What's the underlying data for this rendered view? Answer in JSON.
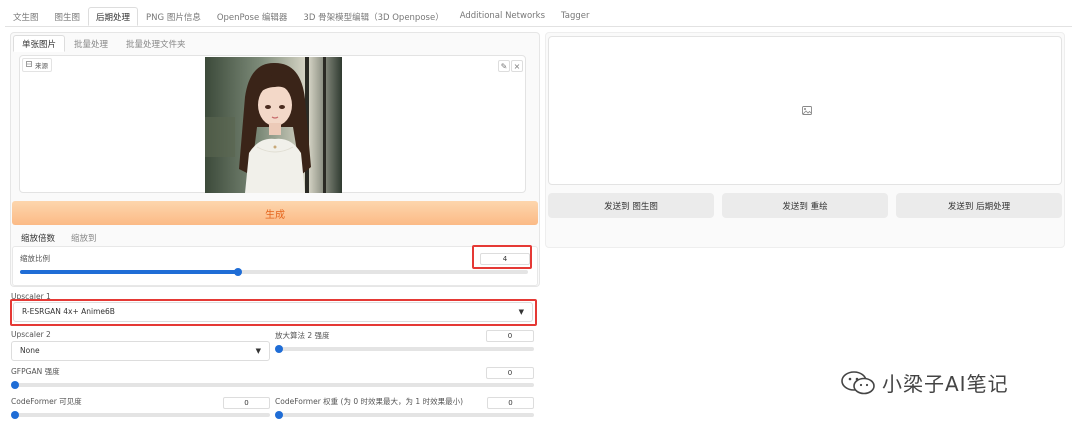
{
  "tabs": [
    "文生图",
    "图生图",
    "后期处理",
    "PNG 图片信息",
    "OpenPose 编辑器",
    "3D 骨架模型编辑（3D Openpose）",
    "Additional Networks",
    "Tagger"
  ],
  "sub_tabs": [
    "单张图片",
    "批量处理",
    "批量处理文件夹"
  ],
  "source_label": "来源",
  "generate_label": "生成",
  "scale_tabs": [
    "缩放倍数",
    "缩放到"
  ],
  "scale_label": "缩放比例",
  "scale_value": "4",
  "scale_fraction": 0.43,
  "upscaler1": {
    "label": "Upscaler 1",
    "value": "R-ESRGAN 4x+ Anime6B"
  },
  "upscaler2": {
    "label": "Upscaler 2",
    "value": "None"
  },
  "upscaler2_strength": {
    "label": "放大算法 2 强度",
    "value": "0"
  },
  "gfpgan": {
    "label": "GFPGAN 强度",
    "value": "0"
  },
  "codeformer_vis": {
    "label": "CodeFormer 可见度",
    "value": "0"
  },
  "codeformer_weight": {
    "label": "CodeFormer 权重 (为 0 时效果最大，为 1 时效果最小)",
    "value": "0"
  },
  "send_buttons": [
    "发送到 图生图",
    "发送到 重绘",
    "发送到 后期处理"
  ],
  "watermark": "小梁子AI笔记",
  "colors": {
    "accent": "#1f6dd6",
    "highlight": "#e53935",
    "generate": "#fbba86"
  }
}
